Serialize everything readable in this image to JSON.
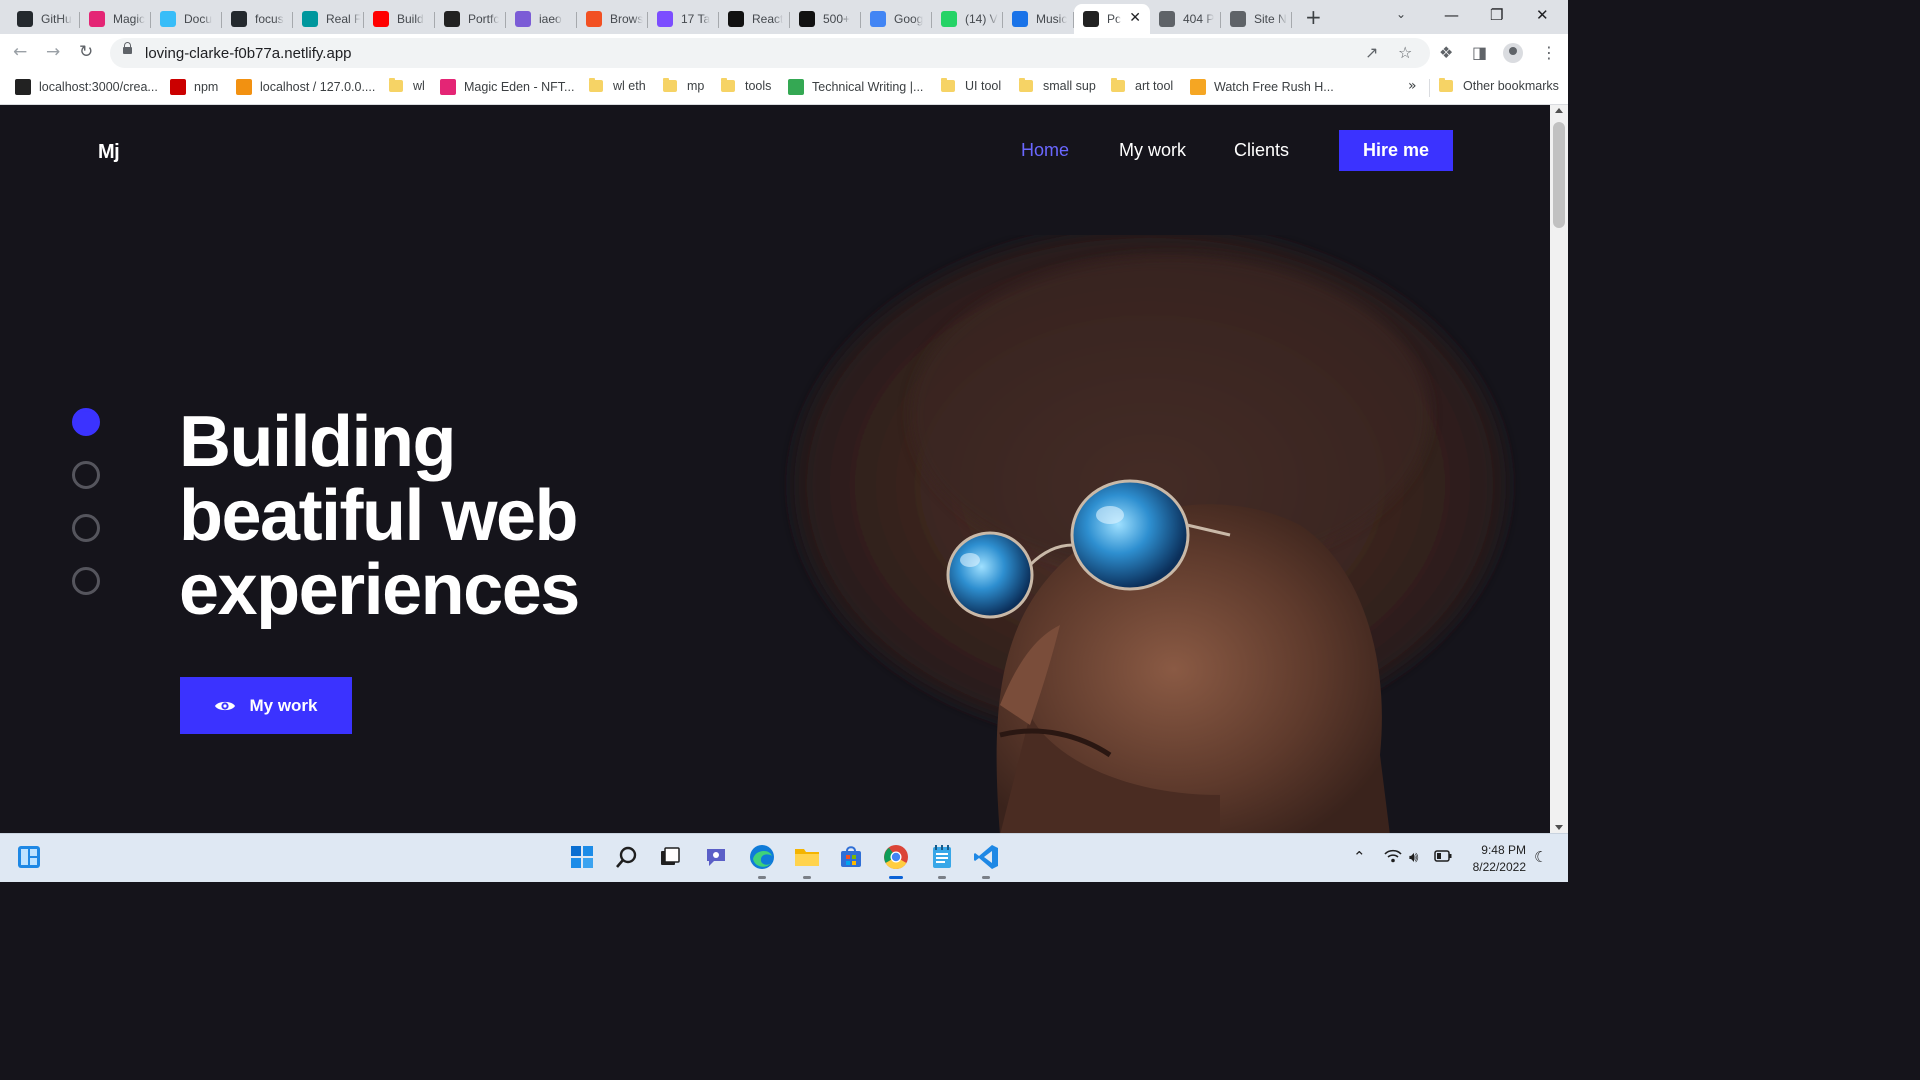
{
  "browser": {
    "tabs": [
      {
        "label": "GitHu",
        "icon": "github-icon",
        "color": "#24292e"
      },
      {
        "label": "Magic",
        "icon": "magic-eden-icon",
        "color": "#e42575"
      },
      {
        "label": "Docu",
        "icon": "tailwind-icon",
        "color": "#38bdf8"
      },
      {
        "label": "focus",
        "icon": "github-icon",
        "color": "#24292e"
      },
      {
        "label": "Real F",
        "icon": "arduino-icon",
        "color": "#00979d"
      },
      {
        "label": "Build",
        "icon": "youtube-icon",
        "color": "#ff0000"
      },
      {
        "label": "Portfc",
        "icon": "react-icon",
        "color": "#222222"
      },
      {
        "label": "iaeo",
        "icon": "heroku-icon",
        "color": "#7b5cd6"
      },
      {
        "label": "Brows",
        "icon": "bing-icon",
        "color": "#f25022"
      },
      {
        "label": "17 Ta",
        "icon": "code-icon",
        "color": "#7c4dff"
      },
      {
        "label": "React",
        "icon": "react-icon",
        "color": "#111111"
      },
      {
        "label": "500+",
        "icon": "unsplash-icon",
        "color": "#111111"
      },
      {
        "label": "Goog",
        "icon": "google-forms-icon",
        "color": "#4285f4"
      },
      {
        "label": "(14) V",
        "icon": "whatsapp-icon",
        "color": "#25d366"
      },
      {
        "label": "Music",
        "icon": "bookmark-icon",
        "color": "#1a73e8"
      },
      {
        "label": "Pc",
        "icon": "react-icon",
        "color": "#222222",
        "active": true
      },
      {
        "label": "404 P",
        "icon": "globe-icon",
        "color": "#5f6368"
      },
      {
        "label": "Site N",
        "icon": "globe-icon",
        "color": "#5f6368"
      }
    ],
    "url": "loving-clarke-f0b77a.netlify.app",
    "bookmarks": [
      {
        "label": "localhost:3000/crea...",
        "kind": "icon",
        "color": "#222222"
      },
      {
        "label": "npm",
        "kind": "icon",
        "color": "#cb0000"
      },
      {
        "label": "localhost / 127.0.0....",
        "kind": "icon",
        "color": "#f29111"
      },
      {
        "label": "wl",
        "kind": "folder"
      },
      {
        "label": "Magic Eden - NFT...",
        "kind": "icon",
        "color": "#e42575"
      },
      {
        "label": "wl eth",
        "kind": "folder"
      },
      {
        "label": "mp",
        "kind": "folder"
      },
      {
        "label": "tools",
        "kind": "folder"
      },
      {
        "label": "Technical Writing |...",
        "kind": "icon",
        "color": "#34a853"
      },
      {
        "label": "UI tool",
        "kind": "folder"
      },
      {
        "label": "small sup",
        "kind": "folder"
      },
      {
        "label": "art tool",
        "kind": "folder"
      },
      {
        "label": "Watch Free Rush H...",
        "kind": "icon",
        "color": "#f5a623"
      }
    ],
    "other_bookmarks": "Other bookmarks"
  },
  "site": {
    "logo": "Mj",
    "nav": [
      "Home",
      "My work",
      "Clients"
    ],
    "hire_label": "Hire me",
    "headline": [
      "Building",
      "beatiful web",
      "experiences"
    ],
    "cta_label": "My work",
    "slide_count": 4,
    "active_slide": 1,
    "accent": "#3b33ff",
    "background": "#15141b"
  },
  "taskbar": {
    "time": "9:48 PM",
    "date": "8/22/2022"
  }
}
